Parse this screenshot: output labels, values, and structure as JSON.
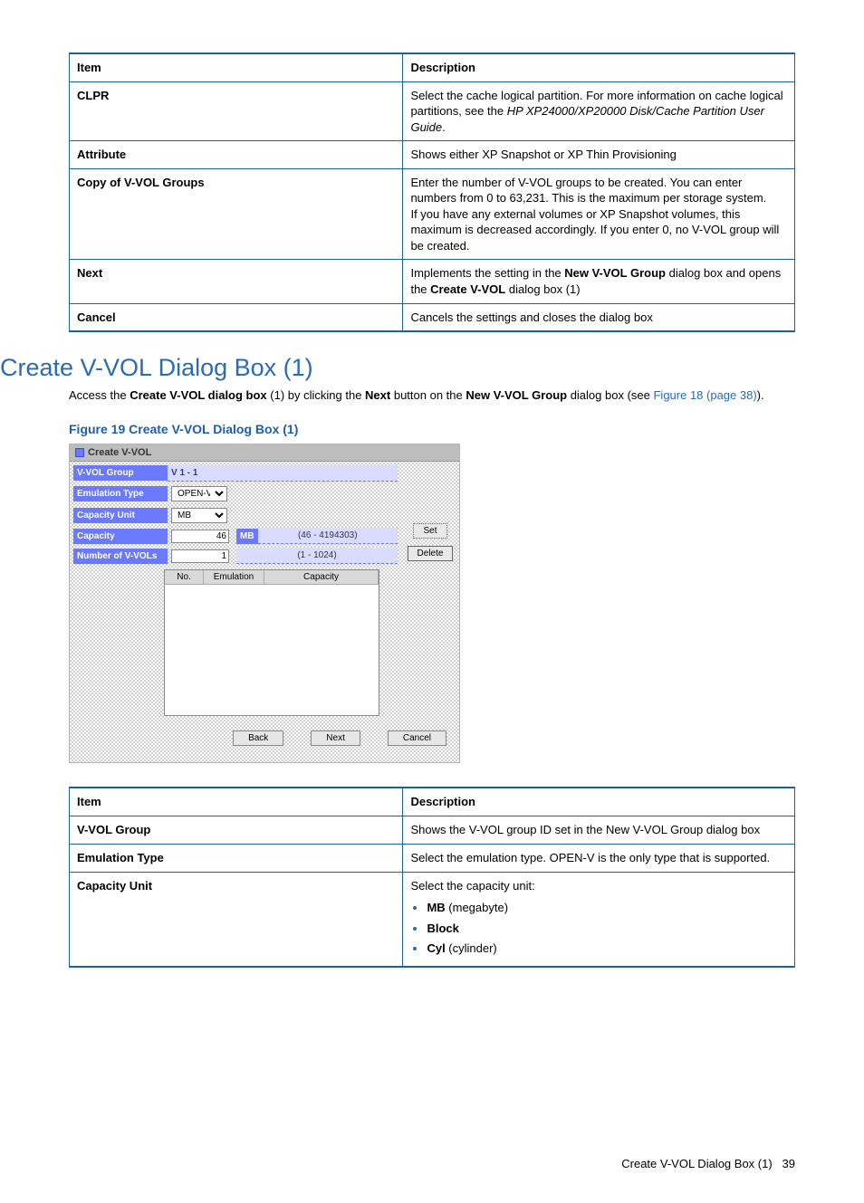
{
  "table1": {
    "head_item": "Item",
    "head_desc": "Description",
    "rows": [
      {
        "item": "CLPR",
        "desc_pre": "Select the cache logical partition. For more information on cache logical partitions, see the ",
        "desc_em": "HP XP24000/XP20000 Disk/Cache Partition User Guide",
        "desc_post": "."
      },
      {
        "item": "Attribute",
        "desc": "Shows either XP Snapshot or XP Thin Provisioning"
      },
      {
        "item": "Copy of V-VOL Groups",
        "desc": "Enter the number of V-VOL groups to be created. You can enter numbers from 0 to 63,231. This is the maximum per storage system.\nIf you have any external volumes or XP Snapshot volumes, this maximum is decreased accordingly. If you enter 0, no V-VOL group will be created."
      },
      {
        "item": "Next",
        "desc_pre": "Implements the setting in the ",
        "desc_b1": "New V-VOL Group",
        "desc_mid": " dialog box and opens the ",
        "desc_b2": "Create V-VOL",
        "desc_post": " dialog box (1)"
      },
      {
        "item": "Cancel",
        "desc": "Cancels the settings and closes the dialog box"
      }
    ]
  },
  "section_title": "Create V-VOL Dialog Box (1)",
  "intro": {
    "pre": "Access the ",
    "b1": "Create V-VOL dialog box",
    "mid1": " (1) by clicking the ",
    "b2": "Next",
    "mid2": " button on the ",
    "b3": "New V-VOL Group",
    "post": " dialog box (see ",
    "link": "Figure 18 (page 38)",
    "end": ")."
  },
  "figcap": "Figure 19 Create V-VOL Dialog Box (1)",
  "dlg": {
    "title": "Create V-VOL",
    "labels": {
      "vvol": "V-VOL Group",
      "emu": "Emulation Type",
      "capu": "Capacity Unit",
      "cap": "Capacity",
      "num": "Number of V-VOLs"
    },
    "vvol_value": "V 1 - 1",
    "emu_value": "OPEN-V",
    "capu_value": "MB",
    "cap_value": "46",
    "cap_unit": "MB",
    "cap_range": "(46 - 4194303)",
    "num_value": "1",
    "num_range": "(1 - 1024)",
    "set": "Set",
    "delete": "Delete",
    "list": {
      "no": "No.",
      "emu": "Emulation",
      "cap": "Capacity"
    },
    "back": "Back",
    "next": "Next",
    "cancel": "Cancel"
  },
  "table2": {
    "head_item": "Item",
    "head_desc": "Description",
    "rows": [
      {
        "item": "V-VOL Group",
        "desc": "Shows the V-VOL group ID set in the New V-VOL Group dialog box"
      },
      {
        "item": "Emulation Type",
        "desc": "Select the emulation type. OPEN-V is the only type that is supported."
      },
      {
        "item": "Capacity Unit",
        "desc_lead": "Select the capacity unit:",
        "items": [
          {
            "b": "MB",
            "t": " (megabyte)"
          },
          {
            "b": "Block",
            "t": ""
          },
          {
            "b": "Cyl",
            "t": " (cylinder)"
          }
        ]
      }
    ]
  },
  "footer": {
    "title": "Create V-VOL Dialog Box (1)",
    "page": "39"
  }
}
